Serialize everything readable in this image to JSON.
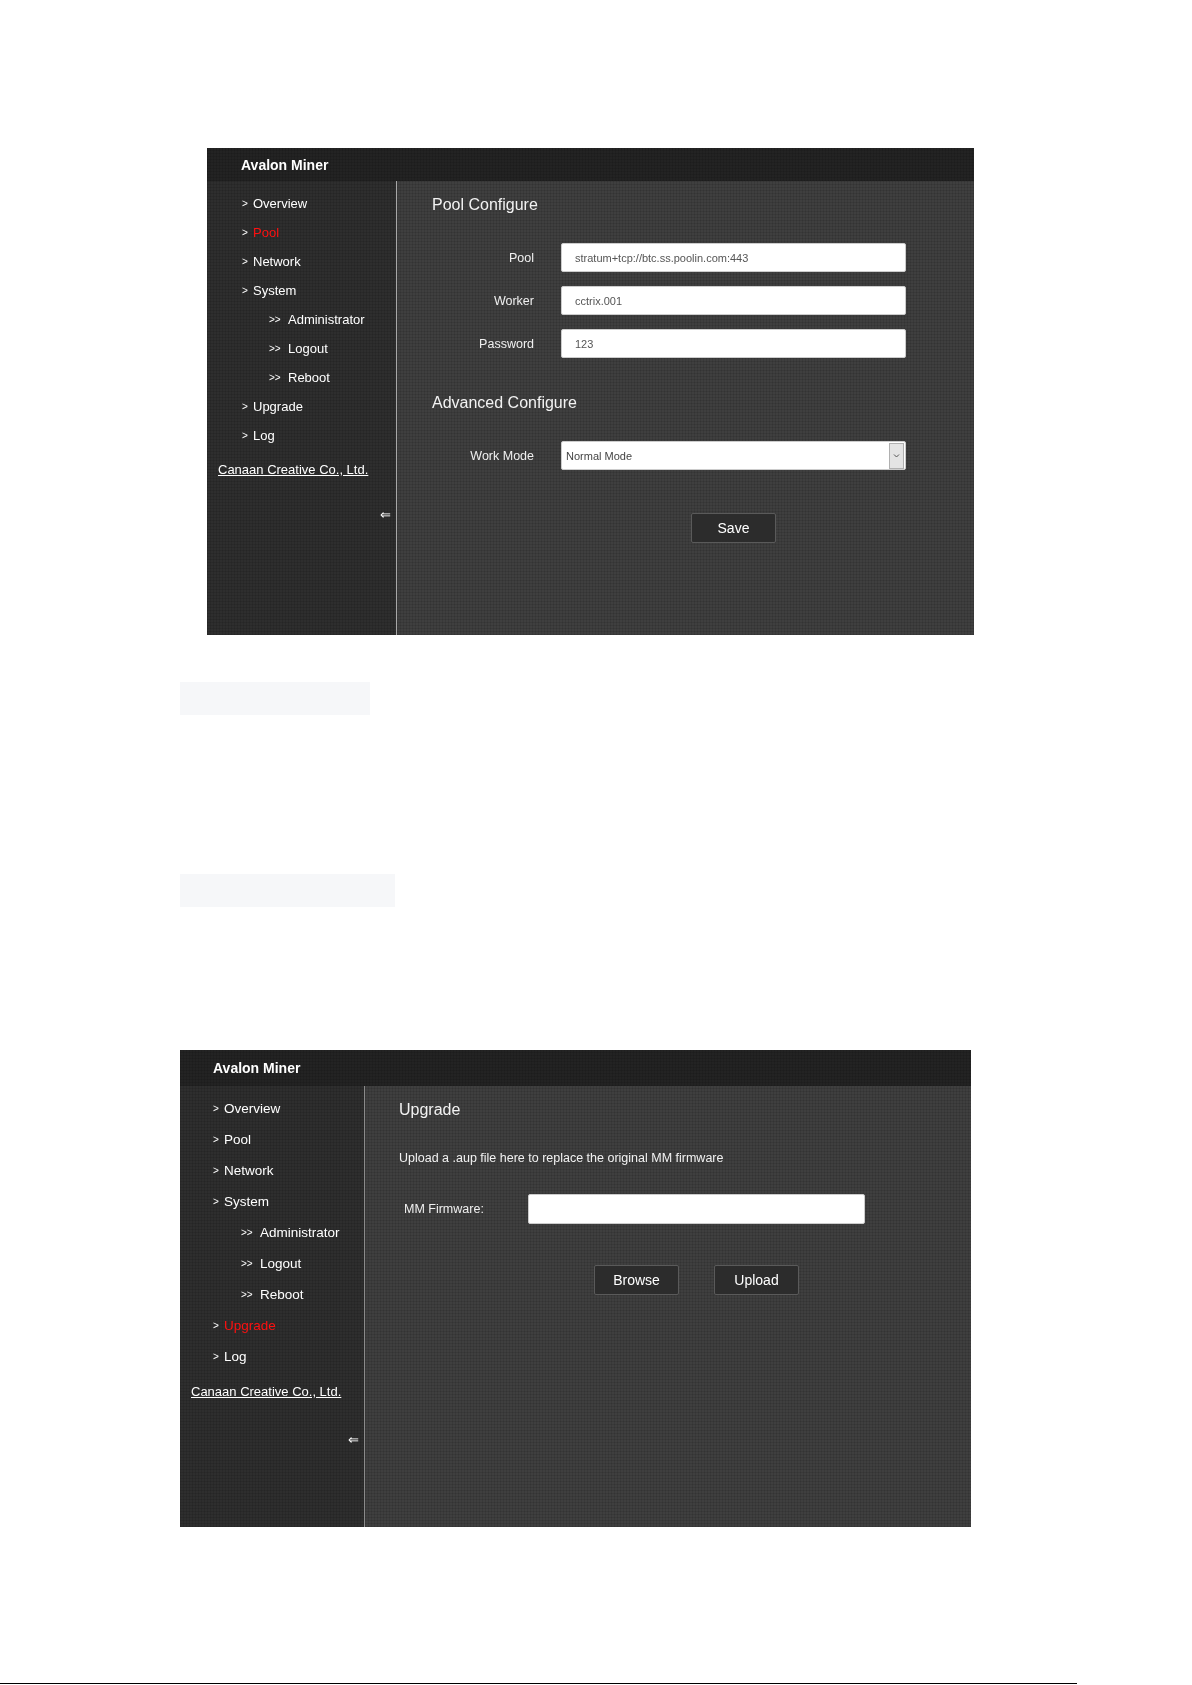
{
  "screens": [
    {
      "header": {
        "title": "Avalon Miner"
      },
      "sidebar": {
        "items": [
          {
            "marker": ">",
            "label": "Overview",
            "selected": false
          },
          {
            "marker": ">",
            "label": "Pool",
            "selected": true
          },
          {
            "marker": ">",
            "label": "Network",
            "selected": false
          },
          {
            "marker": ">",
            "label": "System",
            "selected": false,
            "children": [
              {
                "marker": ">>",
                "label": "Administrator",
                "selected": false
              },
              {
                "marker": ">>",
                "label": "Logout",
                "selected": false
              },
              {
                "marker": ">>",
                "label": "Reboot",
                "selected": false
              }
            ]
          },
          {
            "marker": ">",
            "label": "Upgrade",
            "selected": false
          },
          {
            "marker": ">",
            "label": "Log",
            "selected": false
          }
        ],
        "company_link": "Canaan Creative Co., Ltd.",
        "collapse_toggle": "⇐"
      },
      "main": {
        "sections": [
          {
            "title": "Pool Configure",
            "fields": [
              {
                "kind": "text",
                "label": "Pool",
                "value": "stratum+tcp://btc.ss.poolin.com:443"
              },
              {
                "kind": "text",
                "label": "Worker",
                "value": "cctrix.001"
              },
              {
                "kind": "text",
                "label": "Password",
                "value": "123"
              }
            ]
          },
          {
            "title": "Advanced Configure",
            "fields": [
              {
                "kind": "select",
                "label": "Work Mode",
                "value": "Normal Mode"
              }
            ]
          }
        ],
        "buttons": [
          "Save"
        ]
      }
    },
    {
      "header": {
        "title": "Avalon Miner"
      },
      "sidebar": {
        "items": [
          {
            "marker": ">",
            "label": "Overview",
            "selected": false
          },
          {
            "marker": ">",
            "label": "Pool",
            "selected": false
          },
          {
            "marker": ">",
            "label": "Network",
            "selected": false
          },
          {
            "marker": ">",
            "label": "System",
            "selected": false,
            "children": [
              {
                "marker": ">>",
                "label": "Administrator",
                "selected": false
              },
              {
                "marker": ">>",
                "label": "Logout",
                "selected": false
              },
              {
                "marker": ">>",
                "label": "Reboot",
                "selected": false
              }
            ]
          },
          {
            "marker": ">",
            "label": "Upgrade",
            "selected": true
          },
          {
            "marker": ">",
            "label": "Log",
            "selected": false
          }
        ],
        "company_link": "Canaan Creative Co., Ltd.",
        "collapse_toggle": "⇐"
      },
      "main": {
        "sections": [
          {
            "title": "Upgrade",
            "description": "Upload a .aup file here to replace the original MM firmware",
            "fields": [
              {
                "kind": "file",
                "label": "MM Firmware:"
              }
            ]
          }
        ],
        "buttons": [
          "Browse",
          "Upload"
        ]
      }
    }
  ]
}
